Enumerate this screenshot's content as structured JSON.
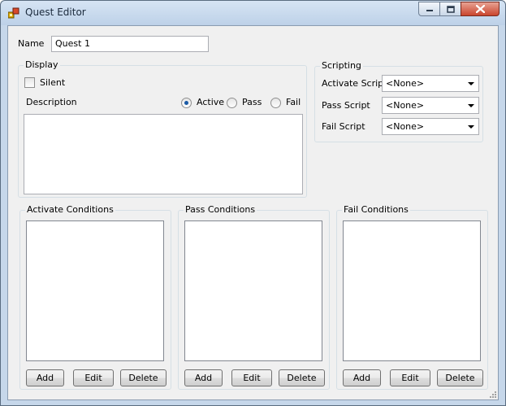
{
  "window": {
    "title": "Quest Editor"
  },
  "name_field": {
    "label": "Name",
    "value": "Quest 1"
  },
  "display": {
    "group_title": "Display",
    "silent_label": "Silent",
    "silent_checked": false,
    "description_label": "Description",
    "description_value": "",
    "radios": [
      {
        "label": "Active",
        "checked": true
      },
      {
        "label": "Pass",
        "checked": false
      },
      {
        "label": "Fail",
        "checked": false
      }
    ]
  },
  "scripting": {
    "group_title": "Scripting",
    "rows": [
      {
        "label": "Activate Script",
        "value": "<None>"
      },
      {
        "label": "Pass Script",
        "value": "<None>"
      },
      {
        "label": "Fail Script",
        "value": "<None>"
      }
    ]
  },
  "conditions": [
    {
      "title": "Activate Conditions",
      "add": "Add",
      "edit": "Edit",
      "delete": "Delete"
    },
    {
      "title": "Pass Conditions",
      "add": "Add",
      "edit": "Edit",
      "delete": "Delete"
    },
    {
      "title": "Fail Conditions",
      "add": "Add",
      "edit": "Edit",
      "delete": "Delete"
    }
  ],
  "colors": {
    "window_frame": "#c6d7ea",
    "client_background": "#f0f0f0",
    "close_button": "#c9452d",
    "radio_dot": "#1a5aa6"
  }
}
